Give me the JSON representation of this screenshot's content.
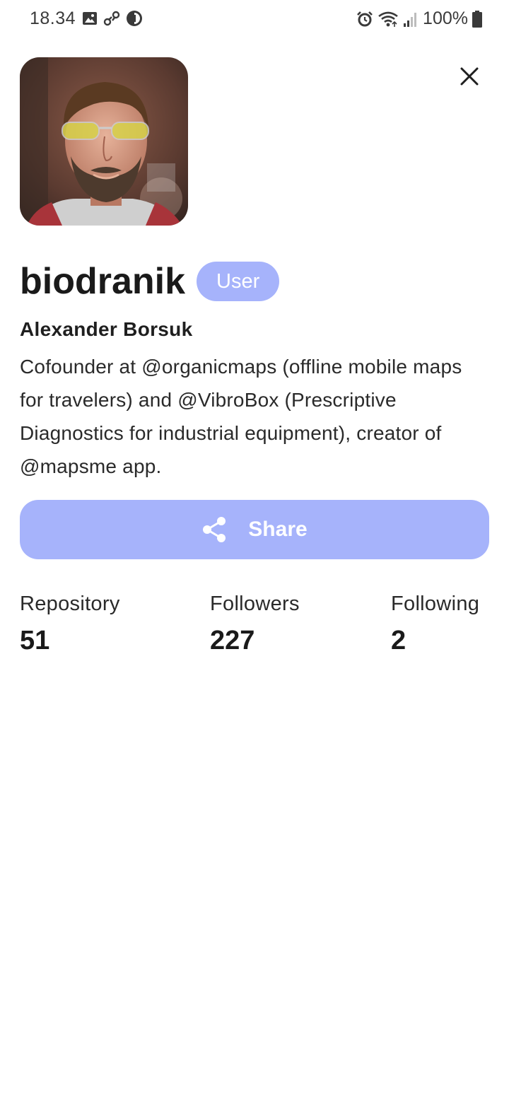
{
  "status_bar": {
    "time": "18.34",
    "battery": "100%"
  },
  "profile": {
    "username": "biodranik",
    "role": "User",
    "full_name": "Alexander Borsuk",
    "bio": "Cofounder at @organicmaps (offline mobile maps for travelers) and @VibroBox (Prescriptive Diagnostics for industrial equipment), creator of @mapsme app."
  },
  "share": {
    "label": "Share"
  },
  "stats": [
    {
      "label": "Repository",
      "value": "51"
    },
    {
      "label": "Followers",
      "value": "227"
    },
    {
      "label": "Following",
      "value": "2"
    }
  ],
  "colors": {
    "accent": "#a6b3fb",
    "text": "#1a1a1a",
    "background": "#ffffff"
  },
  "icons": {
    "status_left": [
      "image-icon",
      "link-icon",
      "data-saver-icon"
    ],
    "status_right": [
      "alarm-icon",
      "wifi-icon",
      "signal-icon",
      "battery-icon"
    ],
    "close": "close-icon",
    "share": "share-icon"
  }
}
